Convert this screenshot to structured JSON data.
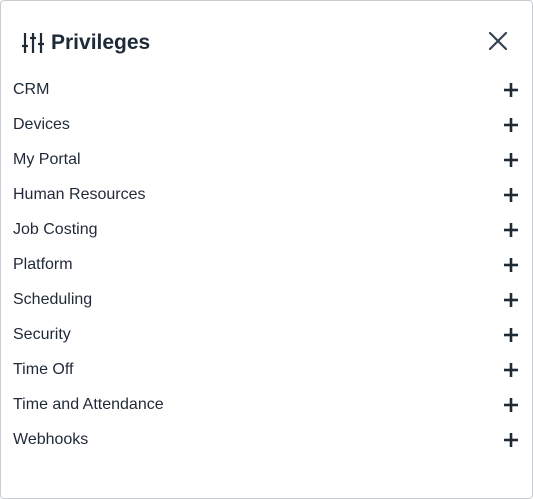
{
  "dialog": {
    "title": "Privileges",
    "title_icon": "sliders-icon",
    "close_icon": "close-icon"
  },
  "privileges": [
    {
      "label": "CRM",
      "icon": "plus-icon"
    },
    {
      "label": "Devices",
      "icon": "plus-icon"
    },
    {
      "label": "My Portal",
      "icon": "plus-icon"
    },
    {
      "label": "Human Resources",
      "icon": "plus-icon"
    },
    {
      "label": "Job Costing",
      "icon": "plus-icon"
    },
    {
      "label": "Platform",
      "icon": "plus-icon"
    },
    {
      "label": "Scheduling",
      "icon": "plus-icon"
    },
    {
      "label": "Security",
      "icon": "plus-icon"
    },
    {
      "label": "Time Off",
      "icon": "plus-icon"
    },
    {
      "label": "Time and Attendance",
      "icon": "plus-icon"
    },
    {
      "label": "Webhooks",
      "icon": "plus-icon"
    }
  ],
  "colors": {
    "text": "#1f2937",
    "title": "#1f2a37",
    "border": "#c9cdd2",
    "background": "#ffffff"
  }
}
